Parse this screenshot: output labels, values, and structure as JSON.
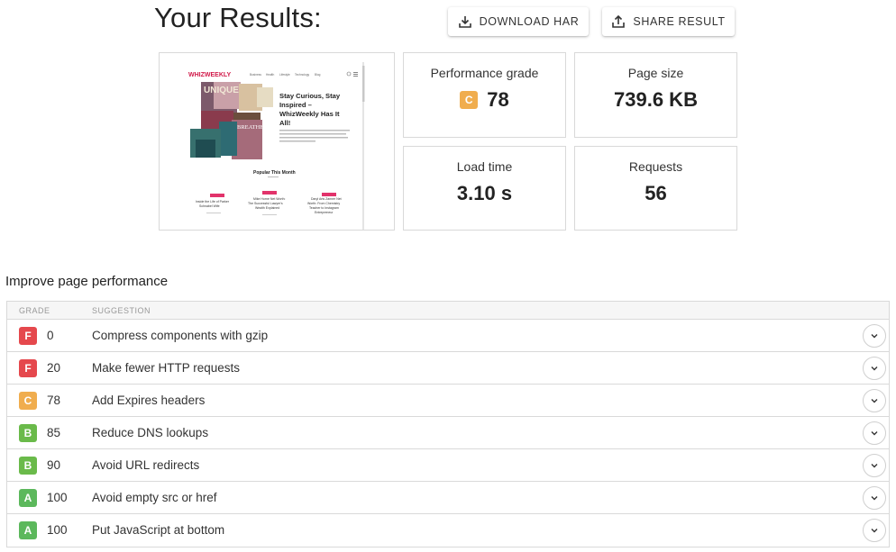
{
  "header": {
    "title": "Your Results:",
    "download_label": "DOWNLOAD HAR",
    "share_label": "SHARE RESULT"
  },
  "preview": {
    "logo": "WHIZWEEKLY",
    "nav": [
      "Business",
      "Health",
      "Lifestyle",
      "Technology",
      "Blog"
    ],
    "headline": "Stay Curious, Stay Inspired – WhizWeekly Has It All!",
    "popular_heading": "Popular This Month",
    "articles": [
      "Inside the Life of Parker Schnabel Wife",
      "Mike Horne Net Worth: The Successful Lawyer's Wealth Explained",
      "Daryl Arts Zanner Net Worth: From Chemistry Teacher to Instagram Entrepreneur"
    ]
  },
  "metrics": {
    "performance_grade": {
      "label": "Performance grade",
      "letter": "C",
      "value": "78"
    },
    "page_size": {
      "label": "Page size",
      "value": "739.6 KB"
    },
    "load_time": {
      "label": "Load time",
      "value": "3.10 s"
    },
    "requests": {
      "label": "Requests",
      "value": "56"
    }
  },
  "improve": {
    "title": "Improve page performance",
    "col_grade": "GRADE",
    "col_suggestion": "SUGGESTION",
    "rows": [
      {
        "grade": "F",
        "score": "0",
        "suggestion": "Compress components with gzip"
      },
      {
        "grade": "F",
        "score": "20",
        "suggestion": "Make fewer HTTP requests"
      },
      {
        "grade": "C",
        "score": "78",
        "suggestion": "Add Expires headers"
      },
      {
        "grade": "B",
        "score": "85",
        "suggestion": "Reduce DNS lookups"
      },
      {
        "grade": "B",
        "score": "90",
        "suggestion": "Avoid URL redirects"
      },
      {
        "grade": "A",
        "score": "100",
        "suggestion": "Avoid empty src or href"
      },
      {
        "grade": "A",
        "score": "100",
        "suggestion": "Put JavaScript at bottom"
      }
    ]
  },
  "colors": {
    "grade_A": "#5cb85c",
    "grade_B": "#6aba4a",
    "grade_C": "#f0ad4e",
    "grade_F": "#e5484d",
    "accent_pink": "#e2336b"
  },
  "icons": {
    "download": "download-icon",
    "share": "share-icon",
    "expand": "chevron-down-icon"
  }
}
